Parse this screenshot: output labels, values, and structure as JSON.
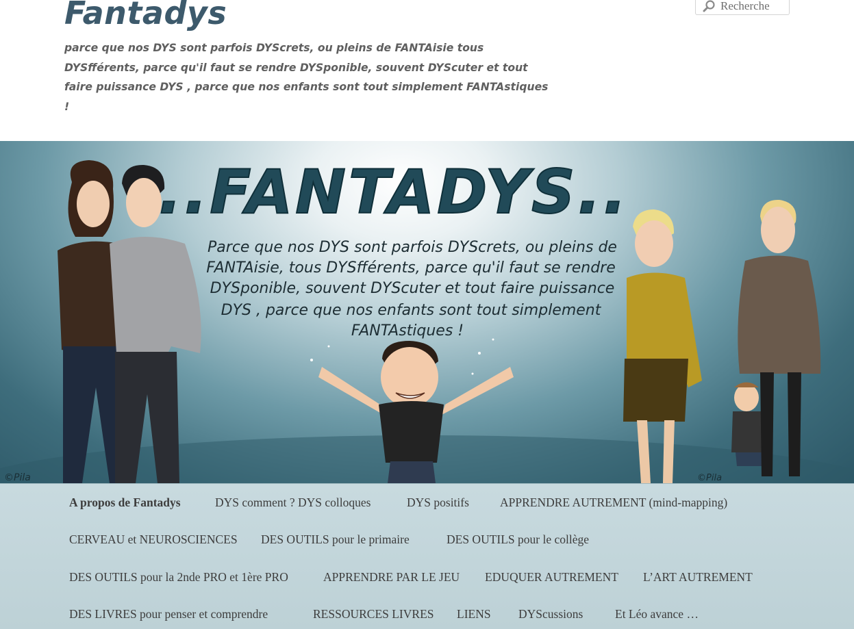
{
  "site": {
    "title": "Fantadys",
    "tagline": "parce que nos DYS sont parfois DYScrets, ou pleins de FANTAisie tous DYSfférents, parce qu'il faut se rendre DYSponible, souvent DYScuter et tout faire puissance DYS , parce que nos enfants sont tout simplement FANTAstiques !"
  },
  "search": {
    "placeholder": "Recherche",
    "icon": "search-icon"
  },
  "banner": {
    "logo_text": "..FANTADYS..",
    "lines": [
      "Parce que nos DYS sont parfois DYScrets, ou pleins de",
      "FANTAisie, tous DYSfférents, parce qu'il faut se rendre",
      "DYSponible, souvent DYScuter et tout faire puissance",
      "DYS , parce que nos enfants sont tout simplement",
      "FANTAstiques !"
    ],
    "signature_left": "©Pila",
    "signature_right": "©Pila"
  },
  "nav": {
    "rows": [
      [
        "A propos de Fantadys",
        "DYS comment ? DYS colloques",
        "DYS positifs",
        "APPRENDRE AUTREMENT (mind-mapping)"
      ],
      [
        "CERVEAU et NEUROSCIENCES",
        "DES OUTILS pour le primaire",
        "DES OUTILS pour le collège"
      ],
      [
        "DES OUTILS pour la 2nde PRO et 1ère PRO",
        "APPRENDRE PAR LE JEU",
        "EDUQUER AUTREMENT",
        "L’ART AUTREMENT"
      ],
      [
        "DES LIVRES pour penser et comprendre",
        "RESSOURCES LIVRES",
        "LIENS",
        "DYScussions",
        "Et Léo avance …"
      ]
    ],
    "active": "A propos de Fantadys"
  },
  "colors": {
    "title": "#3d5a6c",
    "tagline": "#5f5f5f",
    "nav_bg": "#c3d6db",
    "nav_text": "#3d3d3d"
  }
}
